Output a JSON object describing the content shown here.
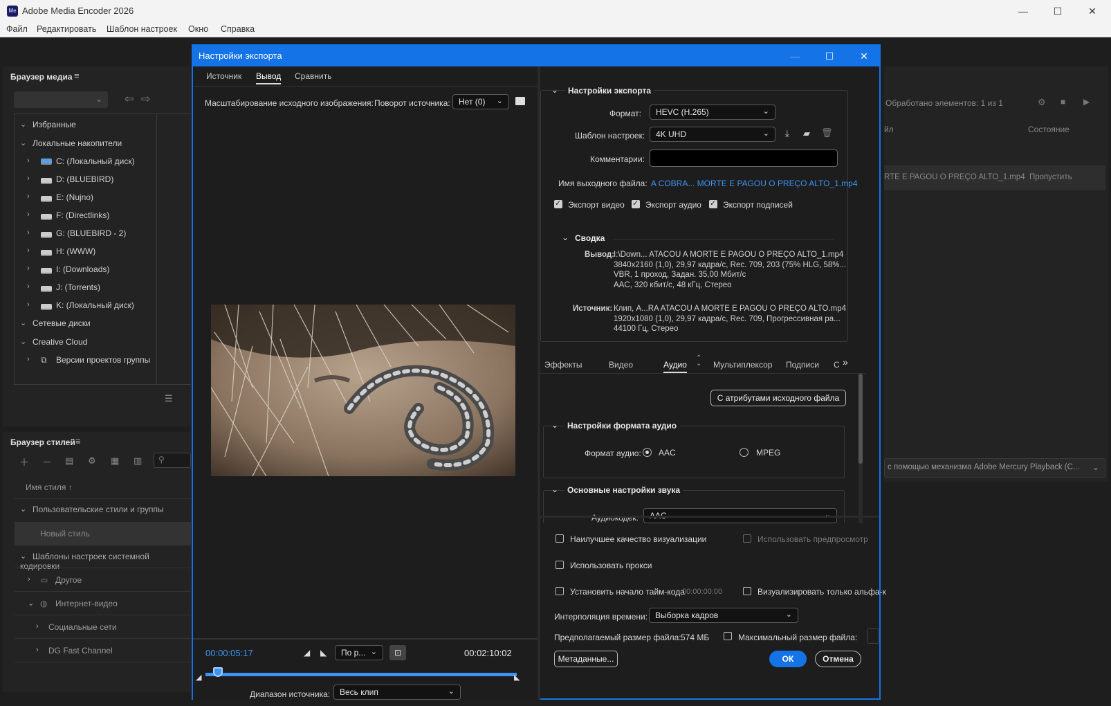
{
  "app": {
    "title": "Adobe Media Encoder 2026",
    "logo": "Me"
  },
  "menu": [
    "Файл",
    "Редактировать",
    "Шаблон настроек",
    "Окно",
    "Справка"
  ],
  "media_browser": {
    "title": "Браузер медиа",
    "favorites": "Избранные",
    "local_drives": "Локальные накопители",
    "drives": [
      "C: (Локальный диск)",
      "D: (BLUEBIRD)",
      "E: (Nujno)",
      "F: (Directlinks)",
      "G: (BLUEBIRD - 2)",
      "H: (WWW)",
      "I: (Downloads)",
      "J: (Torrents)",
      "K: (Локальный диск)"
    ],
    "network": "Сетевые диски",
    "cc": "Creative Cloud",
    "team_projects": "Версии проектов группы"
  },
  "style_browser": {
    "title": "Браузер стилей",
    "col_name": "Имя стиля",
    "user_group": "Пользовательские стили и группы",
    "new_style": "Новый стиль",
    "system_group": "Шаблоны настроек системной кодировки",
    "other": "Другое",
    "web_video": "Интернет-видео",
    "social": "Социальные сети",
    "dg": "DG Fast Channel"
  },
  "queue": {
    "processed": "Обработано элементов: 1 из 1",
    "col_file": "йл",
    "col_status": "Состояние",
    "item": "RTE E PAGOU O PREÇO ALTO_1.mp4",
    "item_status": "Пропустить",
    "renderer": "с помощью механизма Adobe Mercury Playback (C..."
  },
  "dialog": {
    "title": "Настройки экспорта",
    "tabs": [
      "Источник",
      "Вывод",
      "Сравнить"
    ],
    "scale_label": "Масштабирование исходного изображения:",
    "rotate_label": "Поворот источника:",
    "rotate_value": "Нет (0)",
    "timecode_current": "00:00:05:17",
    "timecode_end": "00:02:10:02",
    "fit_value": "По р...",
    "range_label": "Диапазон источника:",
    "range_value": "Весь клип",
    "playhead_fraction": 0.04
  },
  "export_settings": {
    "section": "Настройки экспорта",
    "format_label": "Формат:",
    "format_value": "HEVC (H.265)",
    "preset_label": "Шаблон настроек:",
    "preset_value": "4K UHD",
    "comments_label": "Комментарии:",
    "output_label": "Имя выходного файла:",
    "output_value": "A COBRA... MORTE E PAGOU O PREÇO ALTO_1.mp4",
    "export_video": "Экспорт видео",
    "export_audio": "Экспорт аудио",
    "export_captions": "Экспорт подписей",
    "summary_label": "Сводка",
    "output_key": "Вывод:",
    "output_lines": [
      "I:\\Down... ATACOU A MORTE E PAGOU O PREÇO ALTO_1.mp4",
      "3840x2160 (1,0), 29,97 кадра/с, Rec. 709, 203 (75% HLG, 58%...",
      "VBR, 1 проход, Задан. 35,00 Мбит/с",
      "AAC, 320 кбит/с, 48 кГц, Стерео"
    ],
    "source_key": "Источник:",
    "source_lines": [
      "Клип, A...RA ATACOU A MORTE E PAGOU O PREÇO ALTO.mp4",
      "1920x1080 (1,0), 29,97 кадра/с, Rec. 709, Прогрессивная ра...",
      "44100 Гц, Стерео"
    ]
  },
  "settings_tabs": [
    "Эффекты",
    "Видео",
    "Аудио",
    "Мультиплексор",
    "Подписи",
    "С"
  ],
  "audio": {
    "match_source": "С атрибутами исходного файла",
    "format_section": "Настройки формата аудио",
    "format_label": "Формат аудио:",
    "opt_aac": "AAC",
    "opt_mpeg": "MPEG",
    "basic_section": "Основные настройки звука",
    "codec_label": "Аудиокодек:",
    "codec_value": "AAC"
  },
  "bottom": {
    "max_quality": "Наилучшее качество визуализации",
    "use_preview": "Использовать предпросмотр",
    "use_proxy": "Использовать прокси",
    "set_timecode": "Установить начало тайм-кода",
    "timecode_value": "00:00:00:00",
    "alpha_only": "Визуализировать только альфа-к",
    "interp_label": "Интерполяция времени:",
    "interp_value": "Выборка кадров",
    "filesize_label": "Предполагаемый размер файла:",
    "filesize_value": "574 МБ",
    "max_filesize": "Максимальный размер файла:",
    "metadata_btn": "Метаданные...",
    "ok_btn": "ОК",
    "cancel_btn": "Отмена"
  },
  "colors": {
    "accent": "#1473e6",
    "bg": "#1e1e1e",
    "panel": "#232323"
  }
}
